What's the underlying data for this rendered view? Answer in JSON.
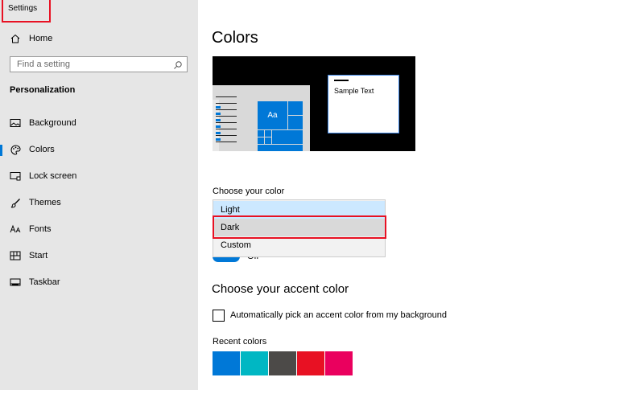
{
  "app": {
    "title": "Settings"
  },
  "sidebar": {
    "home_label": "Home",
    "search_placeholder": "Find a setting",
    "section": "Personalization",
    "items": [
      {
        "label": "Background",
        "icon": "picture-icon"
      },
      {
        "label": "Colors",
        "icon": "palette-icon",
        "selected": true
      },
      {
        "label": "Lock screen",
        "icon": "lock-screen-icon"
      },
      {
        "label": "Themes",
        "icon": "brush-icon"
      },
      {
        "label": "Fonts",
        "icon": "font-icon"
      },
      {
        "label": "Start",
        "icon": "start-grid-icon"
      },
      {
        "label": "Taskbar",
        "icon": "taskbar-icon"
      }
    ]
  },
  "main": {
    "title": "Colors",
    "preview": {
      "sample_text": "Sample Text",
      "tile_label": "Aa"
    },
    "choose_color": {
      "label": "Choose your color",
      "options": [
        "Light",
        "Dark",
        "Custom"
      ],
      "hovered": "Light",
      "highlighted": "Dark"
    },
    "toggle_label": "Off",
    "accent": {
      "heading": "Choose your accent color",
      "auto_pick_label": "Automatically pick an accent color from my background",
      "auto_pick_checked": false,
      "recent_label": "Recent colors",
      "recent_colors": [
        "#0078d7",
        "#00b7c3",
        "#4c4a48",
        "#e81123",
        "#ea005e"
      ]
    }
  },
  "colors": {
    "accent": "#0078d7",
    "highlight_box": "#e81123"
  }
}
